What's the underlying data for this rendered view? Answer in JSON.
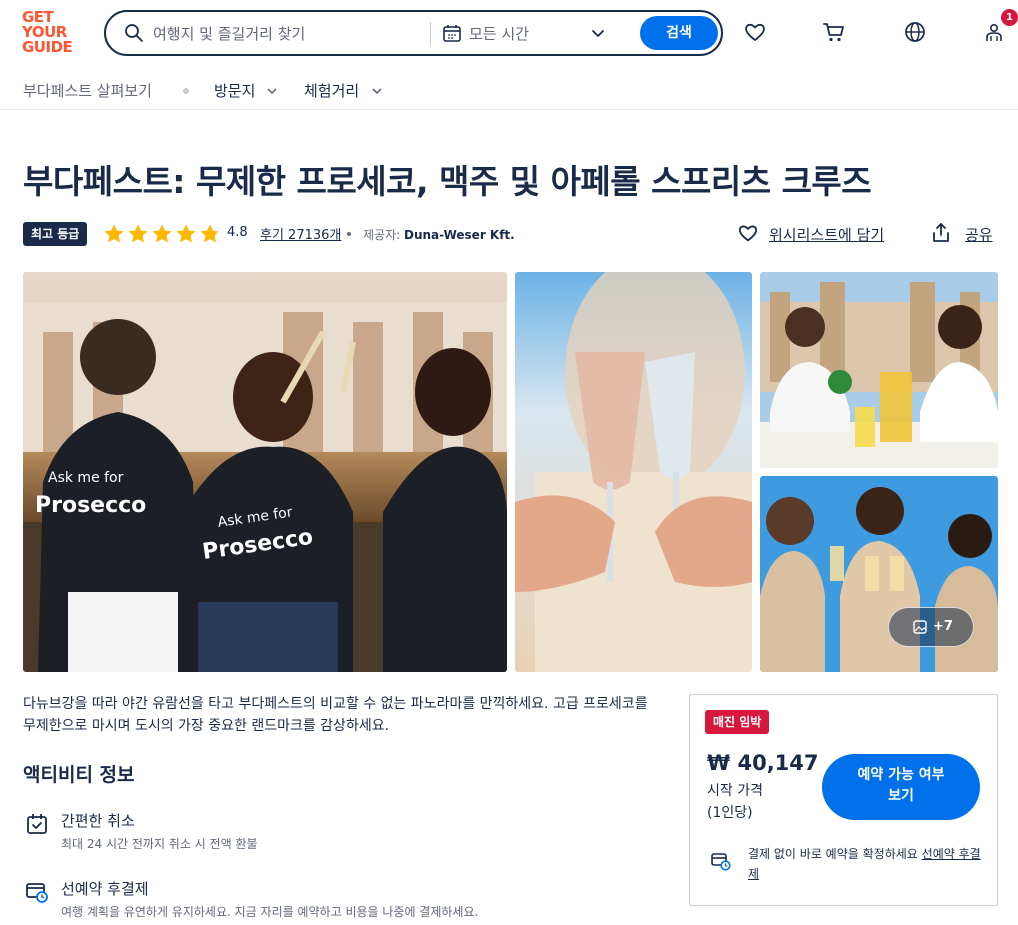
{
  "header": {
    "logo_lines": [
      "GET",
      "YOUR",
      "GUIDE"
    ],
    "search_placeholder": "여행지 및 즐길거리 찾기",
    "date_label": "모든 시간",
    "search_button": "검색",
    "cart_badge": "1",
    "icons": [
      "search-icon",
      "calendar-icon",
      "chevron-down-icon",
      "heart-icon",
      "cart-icon",
      "globe-icon",
      "user-group-icon"
    ]
  },
  "subnav": {
    "explore": "부다페스트 살펴보기",
    "items": [
      "방문지",
      "체험거리"
    ]
  },
  "activity": {
    "title": "부다페스트: 무제한 프로세코, 맥주 및 아페롤 스프리츠 크루즈",
    "badge": "최고 등급",
    "rating": 4.8,
    "rating_text": "4.8",
    "reviews": "후기 27136개",
    "provider_label": "제공자:",
    "provider_name": "Duna-Weser Kft.",
    "wishlist": "위시리스트에 담기",
    "share": "공유"
  },
  "gallery": {
    "more_photos": "+7",
    "images": [
      "tour-staff-back-prosecco",
      "glasses-cheers",
      "women-drinking-parliament",
      "group-toast"
    ]
  },
  "description": "다뉴브강을 따라 야간 유람선을 타고 부다페스트의 비교할 수 없는 파노라마를 만끽하세요. 고급 프로세코를 무제한으로 마시며 도시의 가장 중요한 랜드마크를 감상하세요.",
  "info": {
    "title": "액티비티 정보",
    "features": [
      {
        "icon": "calendar-check-icon",
        "title": "간편한 취소",
        "subtitle": "최대 24 시간 전까지 취소 시 전액 환불"
      },
      {
        "icon": "card-clock-icon",
        "title": "선예약 후결제",
        "subtitle": "여행 계획을 유연하게 유지하세요. 지금 자리를 예약하고 비용을 나중에 결제하세요."
      }
    ]
  },
  "booking": {
    "tag": "매진 임박",
    "price": "₩ 40,147",
    "from": "시작 가격",
    "per": "(1인당)",
    "cta_line1": "예약 가능 여부",
    "cta_line2": "보기",
    "reserve_text": "결제 없이 바로 예약을 확정하세요",
    "reserve_link": "선예약 후결제"
  },
  "colors": {
    "brand": "#ff5533",
    "primary": "#0071eb",
    "text": "#1a2b49",
    "alert": "#d6183f",
    "star": "#ffb800"
  }
}
